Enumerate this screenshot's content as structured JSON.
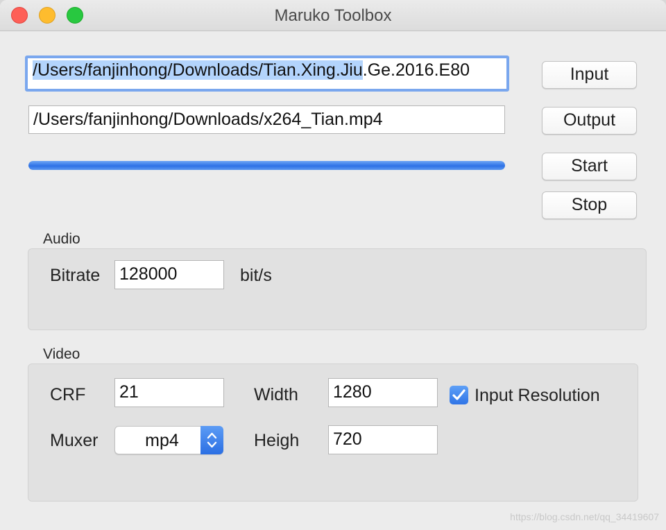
{
  "window": {
    "title": "Maruko Toolbox"
  },
  "io": {
    "input_path_selected": "/Users/fanjinhong/Downloads/Tian.Xing.Jiu",
    "input_path_rest": ".Ge.2016.E80",
    "input_button": "Input",
    "output_path": "/Users/fanjinhong/Downloads/x264_Tian.mp4",
    "output_button": "Output"
  },
  "progress": {
    "fraction": 1.0
  },
  "controls": {
    "start_button": "Start",
    "stop_button": "Stop"
  },
  "audio": {
    "group_label": "Audio",
    "bitrate_label": "Bitrate",
    "bitrate_value": "128000",
    "bitrate_unit": "bit/s"
  },
  "video": {
    "group_label": "Video",
    "crf_label": "CRF",
    "crf_value": "21",
    "muxer_label": "Muxer",
    "muxer_value": "mp4",
    "width_label": "Width",
    "width_value": "1280",
    "height_label": "Heigh",
    "height_value": "720",
    "input_resolution_label": "Input Resolution",
    "input_resolution_checked": true
  },
  "watermark": "https://blog.csdn.net/qq_34419607",
  "icons": {
    "close": "close-icon",
    "minimize": "minimize-icon",
    "zoom": "zoom-icon",
    "popup": "up-down-chevron-icon",
    "check": "checkmark-icon"
  },
  "colors": {
    "accent": "#2f74e6",
    "selection": "#b3d4fc",
    "focus_ring": "#7aa7ee"
  }
}
